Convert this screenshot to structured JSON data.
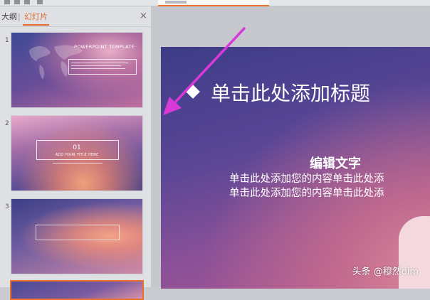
{
  "panel": {
    "tabs": {
      "outline": "大纲",
      "separator": "|",
      "slides": "幻灯片"
    },
    "close_icon": "×"
  },
  "slides": [
    {
      "number": "1",
      "title": "POWERPOINT TEMPLATE"
    },
    {
      "number": "2",
      "big": "01",
      "subtitle": "ADD YOUR TITLE HERE"
    },
    {
      "number": "3"
    },
    {
      "number": "4"
    }
  ],
  "current_slide": {
    "title": "单击此处添加标题",
    "heading": "编辑文字",
    "body": "单击此处添加您的内容单击此处添单击此处添加您的内容单击此处添"
  },
  "watermark": "头条 @穆然oim",
  "colors": {
    "accent": "#e8712c",
    "annotation_arrow": "#d83ad8"
  }
}
